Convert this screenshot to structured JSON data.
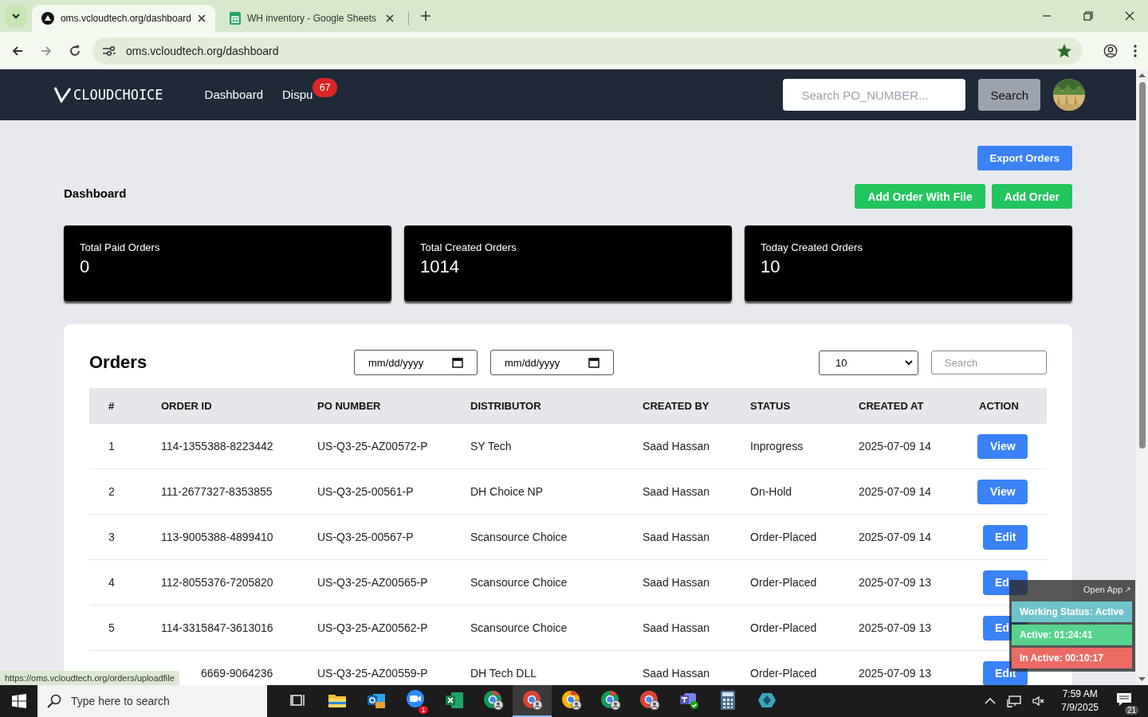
{
  "browser": {
    "tabs": [
      {
        "title": "oms.vcloudtech.org/dashboard",
        "kind": "site",
        "selected": true
      },
      {
        "title": "WH inventory - Google Sheets",
        "kind": "sheets",
        "selected": false
      }
    ],
    "url": "oms.vcloudtech.org/dashboard",
    "bookmarked": true
  },
  "header": {
    "logo": "CLOUDCHOICE",
    "nav": [
      {
        "label": "Dashboard"
      },
      {
        "label": "Dispu",
        "badge": "67"
      }
    ],
    "search_placeholder": "Search PO_NUMBER...",
    "search_button": "Search"
  },
  "page": {
    "export_button": "Export Orders",
    "title": "Dashboard",
    "buttons": [
      "Add Order With File",
      "Add Order"
    ]
  },
  "stats": [
    {
      "label": "Total Paid Orders",
      "value": "0"
    },
    {
      "label": "Total Created Orders",
      "value": "1014"
    },
    {
      "label": "Today Created Orders",
      "value": "10"
    }
  ],
  "orders": {
    "title": "Orders",
    "date_fields": [
      {
        "placeholder": "mm/dd/yyyy"
      },
      {
        "placeholder": "mm/dd/yyyy"
      }
    ],
    "page_size": "10",
    "search_placeholder": "Search",
    "columns": [
      "#",
      "ORDER ID",
      "PO NUMBER",
      "DISTRIBUTOR",
      "CREATED BY",
      "STATUS",
      "CREATED AT",
      "ACTION"
    ],
    "rows": [
      {
        "cells": [
          "1",
          "114-1355388-8223442",
          "US-Q3-25-AZ00572-P",
          "SY Tech",
          "Saad Hassan",
          "Inprogress",
          "2025-07-09 14"
        ],
        "action": {
          "kind": "view",
          "label": "View"
        }
      },
      {
        "cells": [
          "2",
          "111-2677327-8353855",
          "US-Q3-25-00561-P",
          "DH Choice NP",
          "Saad Hassan",
          "On-Hold",
          "2025-07-09 14"
        ],
        "action": {
          "kind": "view",
          "label": "View"
        }
      },
      {
        "cells": [
          "3",
          "113-9005388-4899410",
          "US-Q3-25-00567-P",
          "Scansource Choice",
          "Saad Hassan",
          "Order-Placed",
          "2025-07-09 14"
        ],
        "action": {
          "kind": "edit",
          "label": "Edit"
        }
      },
      {
        "cells": [
          "4",
          "112-8055376-7205820",
          "US-Q3-25-AZ00565-P",
          "Scansource Choice",
          "Saad Hassan",
          "Order-Placed",
          "2025-07-09 13"
        ],
        "action": {
          "kind": "edit",
          "label": "Ed"
        }
      },
      {
        "cells": [
          "5",
          "114-3315847-3613016",
          "US-Q3-25-AZ00562-P",
          "Scansource Choice",
          "Saad Hassan",
          "Order-Placed",
          "2025-07-09 13"
        ],
        "action": {
          "kind": "edit",
          "label": "Ed"
        }
      },
      {
        "cells": [
          "",
          "6669-9064236",
          "US-Q3-25-AZ00559-P",
          "DH Tech DLL",
          "Saad Hassan",
          "Order-Placed",
          "2025-07-09 13"
        ],
        "action": {
          "kind": "edit",
          "label": "Edit"
        }
      }
    ]
  },
  "widget": {
    "open_app": "Open App",
    "statuses": [
      {
        "text": "Working Status: Active",
        "color": "#6fc3cc"
      },
      {
        "text": "Active: 01:24:41",
        "color": "#57d38c"
      },
      {
        "text": "In Active: 00:10:17",
        "color": "#ec6b64"
      }
    ]
  },
  "status_url": "https://oms.vcloudtech.org/orders/uploadfile",
  "taskbar": {
    "search_placeholder": "Type here to search",
    "apps": [
      {
        "kind": "taskview",
        "selected": false
      },
      {
        "kind": "folder",
        "selected": false
      },
      {
        "kind": "mail",
        "selected": false
      },
      {
        "kind": "video",
        "selected": false,
        "badge": "1"
      },
      {
        "kind": "sheet",
        "selected": false
      },
      {
        "kind": "chrome",
        "selected": false
      },
      {
        "kind": "chrome",
        "selected": true
      },
      {
        "kind": "chrome",
        "selected": false
      },
      {
        "kind": "chrome",
        "selected": false
      },
      {
        "kind": "chrome",
        "selected": false
      },
      {
        "kind": "teams",
        "selected": false
      },
      {
        "kind": "calculator",
        "selected": false
      },
      {
        "kind": "diamond",
        "selected": false
      }
    ],
    "time": "7:59 AM",
    "date": "7/9/2025",
    "notifications": "21"
  }
}
